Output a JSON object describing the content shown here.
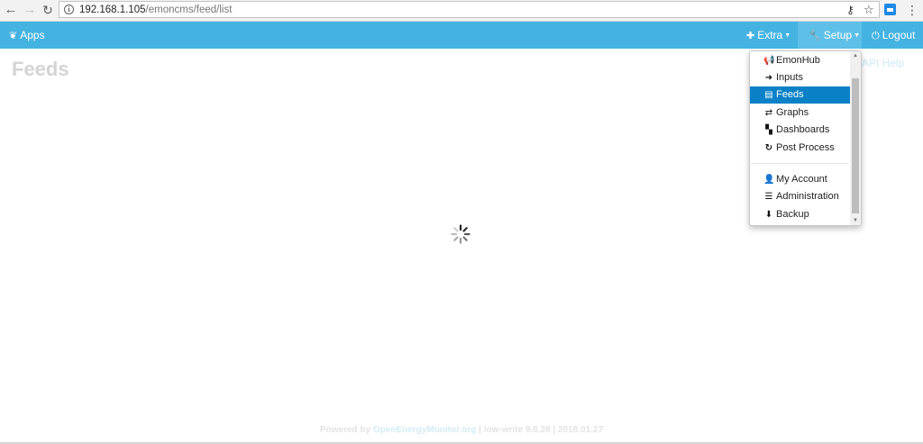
{
  "browser": {
    "url_host": "192.168.1.105",
    "url_path": "/emoncms/feed/list"
  },
  "navbar": {
    "apps_label": "Apps",
    "extra_label": "Extra",
    "setup_label": "Setup",
    "logout_label": "Logout",
    "bg_color": "#44b3e2"
  },
  "page": {
    "title": "Feeds",
    "api_help": "ed API Help"
  },
  "setup_menu": {
    "items": [
      {
        "label": "EmonHub",
        "icon": "megaphone-icon"
      },
      {
        "label": "Inputs",
        "icon": "arrow-right-icon"
      },
      {
        "label": "Feeds",
        "icon": "list-alt-icon",
        "active": true
      },
      {
        "label": "Graphs",
        "icon": "retweet-icon"
      },
      {
        "label": "Dashboards",
        "icon": "th-large-icon"
      },
      {
        "label": "Post Process",
        "icon": "refresh-icon"
      },
      {
        "label": "My Account",
        "icon": "user-icon"
      },
      {
        "label": "Administration",
        "icon": "tasks-icon"
      },
      {
        "label": "Backup",
        "icon": "download-icon"
      }
    ],
    "active_color": "#0a81c6"
  },
  "footer": {
    "powered_by": "Powered by",
    "link_text": "OpenEnergyMonitor.org",
    "version": "| low-write 9.8.28 | 2018.01.27"
  }
}
